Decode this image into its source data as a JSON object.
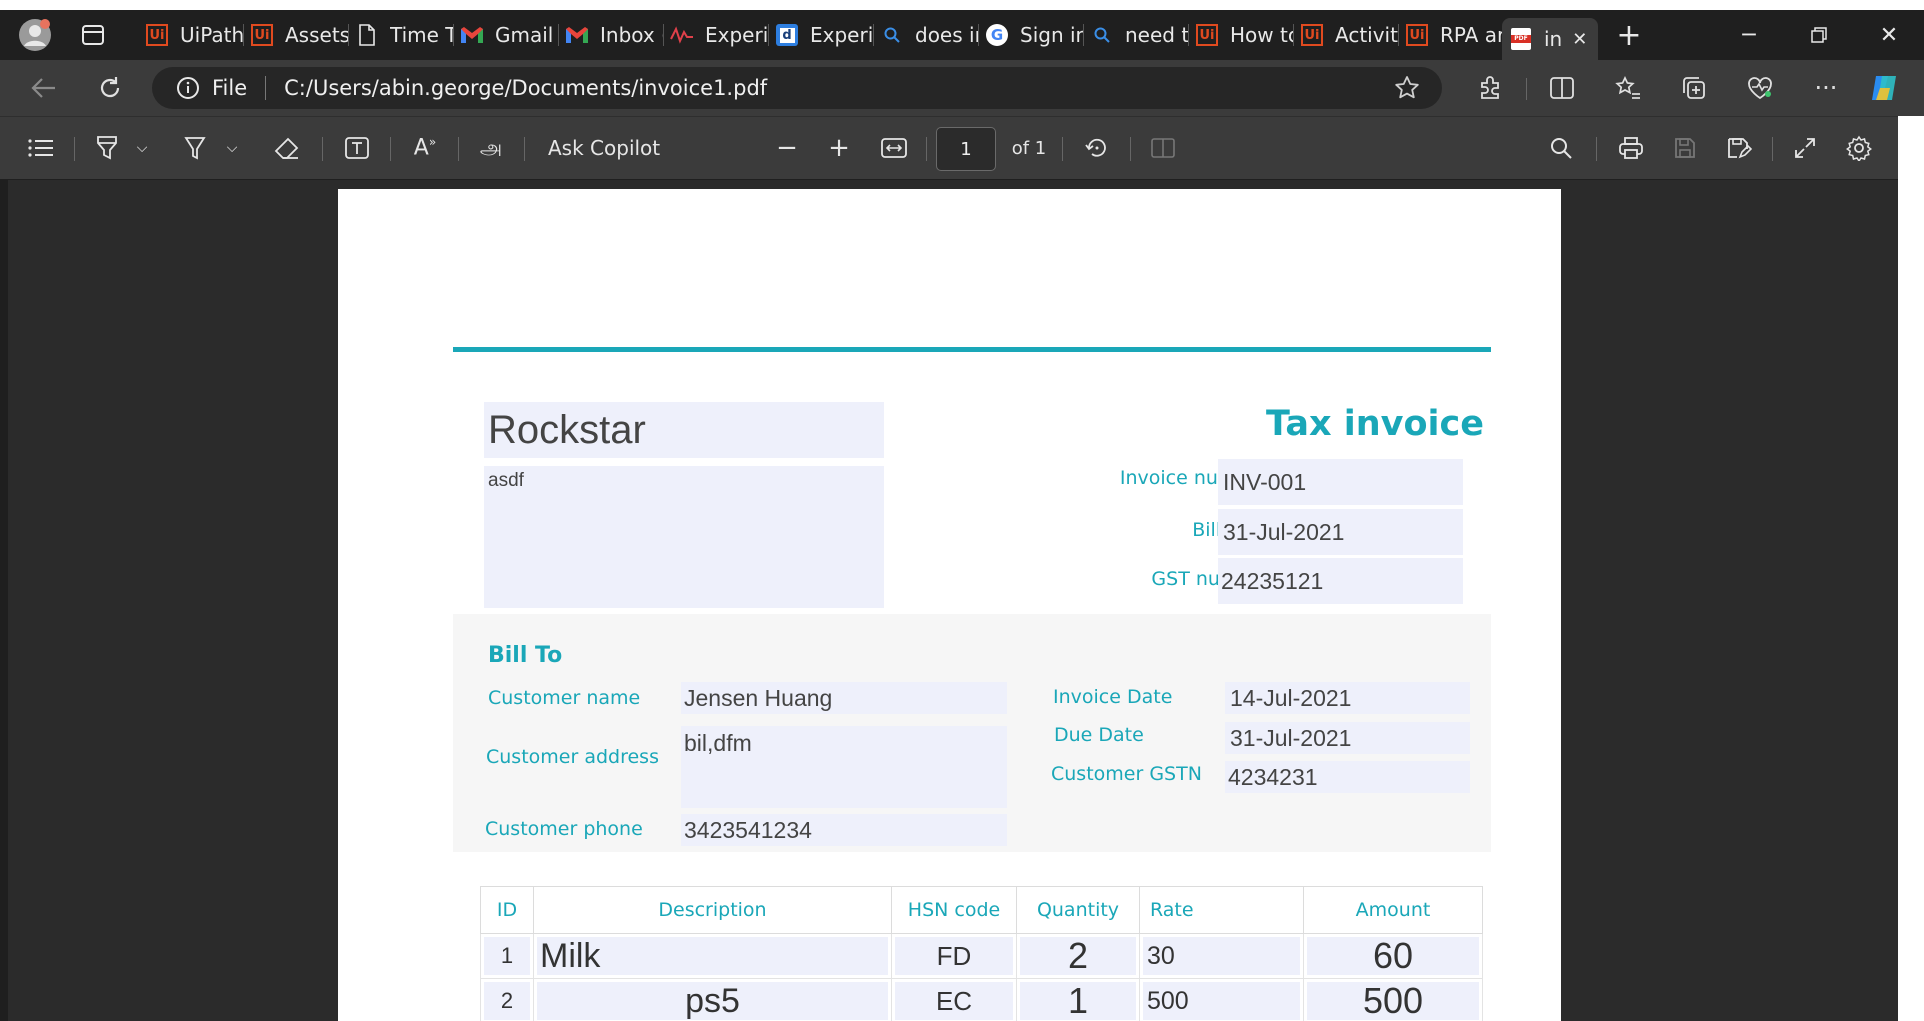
{
  "tabs": [
    {
      "label": "UiPath",
      "icon": "uipath-icon"
    },
    {
      "label": "Assets",
      "icon": "uipath-icon"
    },
    {
      "label": "Time T",
      "icon": "document-icon"
    },
    {
      "label": "Gmail",
      "icon": "gmail-icon"
    },
    {
      "label": "Inbox (",
      "icon": "gmail-icon"
    },
    {
      "label": "Experi",
      "icon": "pulse-icon"
    },
    {
      "label": "Experi",
      "icon": "d-logo-icon"
    },
    {
      "label": "does ir",
      "icon": "search-icon"
    },
    {
      "label": "Sign in",
      "icon": "google-icon"
    },
    {
      "label": "need t",
      "icon": "search-icon"
    },
    {
      "label": "How tc",
      "icon": "uipath-icon"
    },
    {
      "label": "Activit",
      "icon": "uipath-icon"
    },
    {
      "label": "RPA ar",
      "icon": "uipath-icon"
    },
    {
      "label": "in",
      "icon": "pdf-icon",
      "active": true
    }
  ],
  "address": {
    "scheme_label": "File",
    "url": "C:/Users/abin.george/Documents/invoice1.pdf"
  },
  "pdf_toolbar": {
    "ask_copilot": "Ask Copilot",
    "page_current": "1",
    "page_total": "of 1"
  },
  "invoice": {
    "company_name": "Rockstar",
    "company_address": "asdf",
    "title": "Tax invoice",
    "invoice_number_label": "Invoice number",
    "invoice_number": "INV-001",
    "bill_date_label": "Bill date",
    "bill_date": "31-Jul-2021",
    "gst_number_label": "GST number",
    "gst_number": "24235121",
    "bill_to_heading": "Bill To",
    "customer_name_label": "Customer name",
    "customer_name": "Jensen Huang",
    "customer_address_label": "Customer address",
    "customer_address": "bil,dfm",
    "customer_phone_label": "Customer phone",
    "customer_phone": "3423541234",
    "invoice_date_label": "Invoice Date",
    "invoice_date": "14-Jul-2021",
    "due_date_label": "Due Date",
    "due_date": "31-Jul-2021",
    "customer_gstn_label": "Customer GSTN",
    "customer_gstn": "4234231",
    "table": {
      "headers": [
        "ID",
        "Description",
        "HSN code",
        "Quantity",
        "Rate",
        "Amount"
      ],
      "rows": [
        {
          "id": "1",
          "description": "Milk",
          "hsn": "FD",
          "quantity": "2",
          "rate": "30",
          "amount": "60"
        },
        {
          "id": "2",
          "description": "ps5",
          "hsn": "EC",
          "quantity": "1",
          "rate": "500",
          "amount": "500"
        }
      ]
    }
  },
  "colors": {
    "accent": "#1aa7b8",
    "field_bg": "#eef0fb",
    "chrome_dark": "#1f1f1f",
    "toolbar": "#3b3b3b"
  }
}
